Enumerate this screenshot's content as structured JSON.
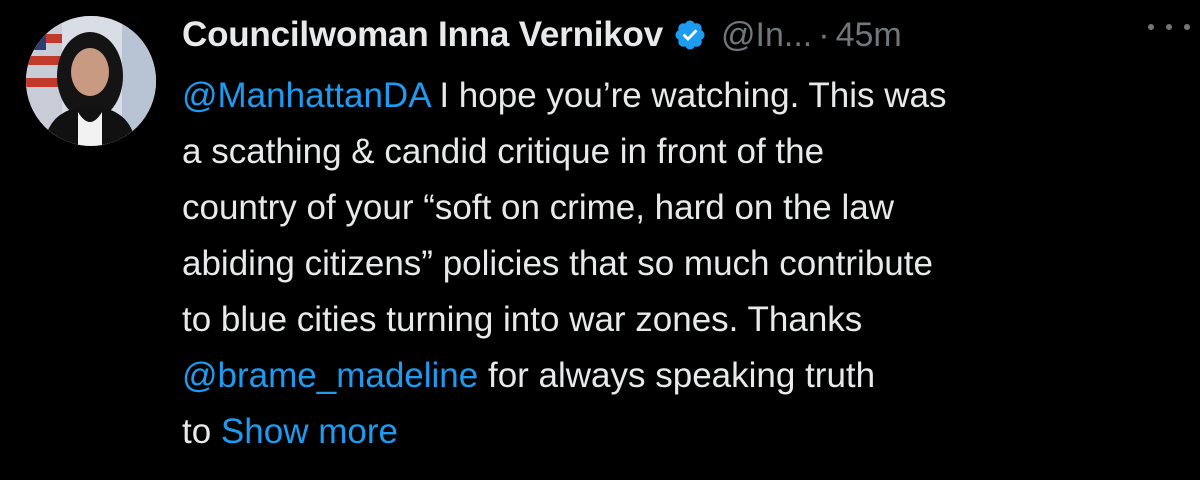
{
  "tweet": {
    "display_name": "Councilwoman Inna Vernikov",
    "handle": "@In...",
    "separator": "·",
    "time": "45m",
    "verified_icon": "verified-badge-icon",
    "more_icon": "more-options-icon",
    "accent_color": "#1d9bf0",
    "lines": [
      {
        "mention": "@ManhattanDA",
        "text": " I hope you’re watching. This was"
      },
      {
        "text": "a scathing & candid critique in front of the"
      },
      {
        "text": "country of your “soft on crime, hard on the law"
      },
      {
        "text": "abiding citizens” policies that so much contribute"
      },
      {
        "text": "to blue cities turning into war zones. Thanks"
      },
      {
        "mention": "@brame_madeline",
        "text": " for always speaking truth"
      },
      {
        "text": "to ",
        "show_more": "Show more"
      }
    ]
  }
}
